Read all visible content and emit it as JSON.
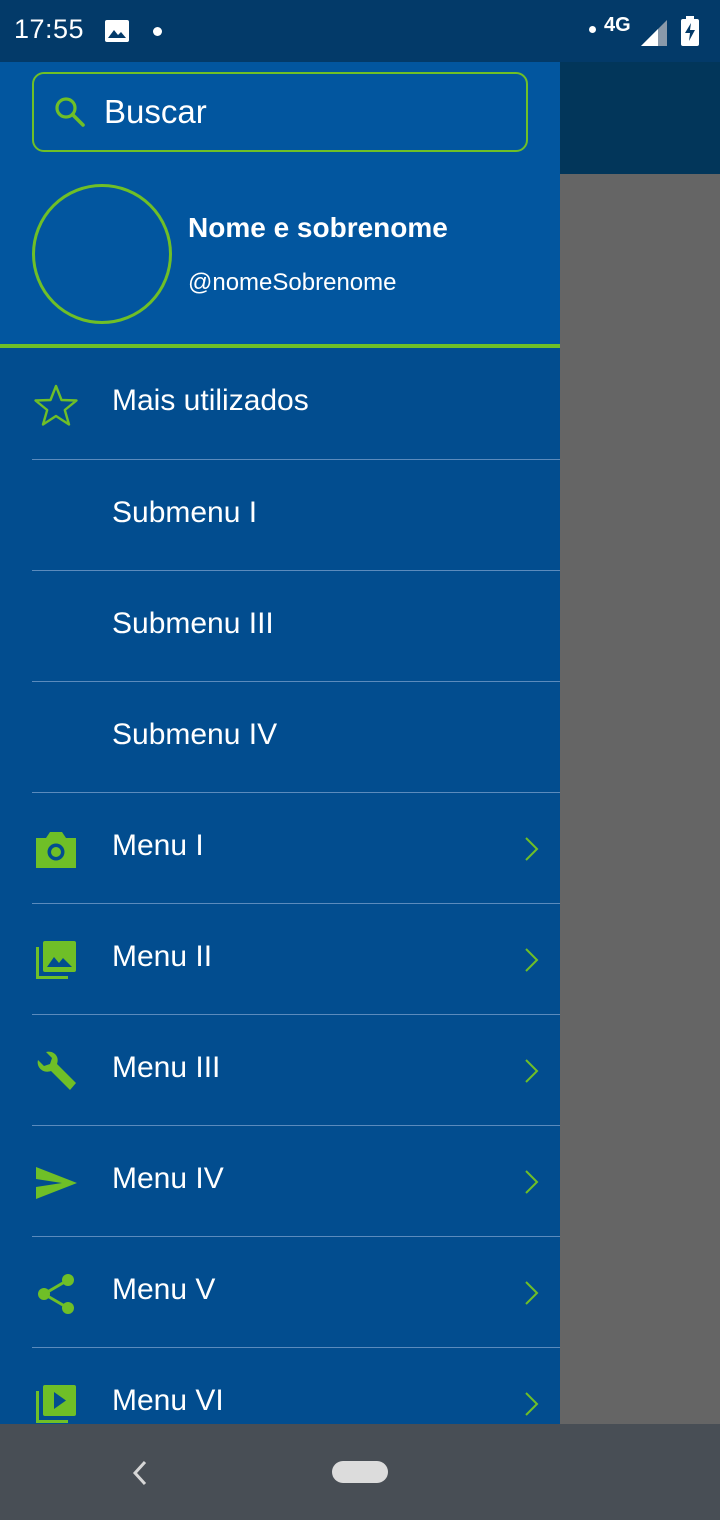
{
  "status_bar": {
    "time": "17:55",
    "network": "4G"
  },
  "search": {
    "placeholder": "Buscar"
  },
  "profile": {
    "name": "Nome e sobrenome",
    "handle": "@nomeSobrenome"
  },
  "menu": {
    "items": [
      {
        "label": "Mais utilizados",
        "icon": "star-outline-icon"
      },
      {
        "label": "Submenu I"
      },
      {
        "label": "Submenu III"
      },
      {
        "label": "Submenu IV"
      },
      {
        "label": "Menu I",
        "icon": "camera-icon"
      },
      {
        "label": "Menu II",
        "icon": "photo-library-icon"
      },
      {
        "label": "Menu III",
        "icon": "wrench-icon"
      },
      {
        "label": "Menu IV",
        "icon": "send-icon"
      },
      {
        "label": "Menu V",
        "icon": "share-icon"
      },
      {
        "label": "Menu VI",
        "icon": "video-library-icon"
      }
    ]
  },
  "colors": {
    "drawer_bg": "#024d8f",
    "header_bg": "#02569f",
    "accent_green": "#6fbf27",
    "status_bar": "#033a69",
    "nav_bar": "#484e55"
  }
}
